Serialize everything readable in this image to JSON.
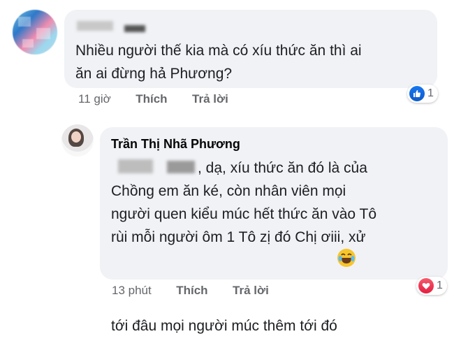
{
  "comments": [
    {
      "text": "Nhiều người thế kia mà có xíu thức ăn thì ai\năn ai đừng hả Phương?",
      "time": "11 giờ",
      "like_label": "Thích",
      "reply_label": "Trả lời",
      "reaction_icon": "like-icon",
      "reaction_count": "1"
    },
    {
      "author": "Trần Thị Nhã Phương",
      "text_line1": "dạ, xíu thức ăn đó là của",
      "text_rest": "Chồng em ăn ké, còn nhân viên mọi\nngười quen kiểu múc hết thức ăn vào Tô\nrùi mỗi người ôm 1 Tô zị đó Chị ơiii, xử\ntới đâu mọi người múc thêm tới đó",
      "time": "13 phút",
      "like_label": "Thích",
      "reply_label": "Trả lời",
      "reaction_icon": "heart-icon",
      "reaction_count": "1"
    }
  ],
  "colors": {
    "bubble": "#f0f2f5",
    "text": "#1c1e21",
    "meta": "#65676b",
    "like": "#1877f2",
    "love": "#e41e3f"
  }
}
